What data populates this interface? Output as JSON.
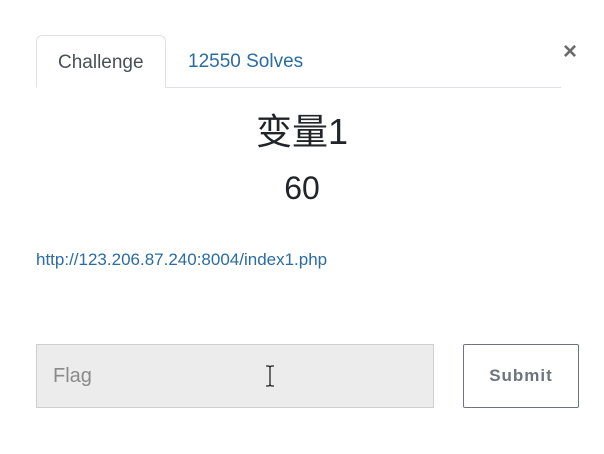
{
  "tabs": [
    {
      "label": "Challenge",
      "active": true
    },
    {
      "label": "12550 Solves",
      "active": false
    }
  ],
  "close_label": "×",
  "challenge": {
    "title": "变量1",
    "value": "60",
    "link": "http://123.206.87.240:8004/index1.php"
  },
  "flag_input": {
    "placeholder": "Flag",
    "value": ""
  },
  "submit_label": "Submit",
  "colors": {
    "link": "#2b6ca3",
    "input_bg": "#ececec",
    "button_border": "#6c757d"
  },
  "icons": {
    "cursor": "text-cursor-icon",
    "close": "close-icon"
  }
}
